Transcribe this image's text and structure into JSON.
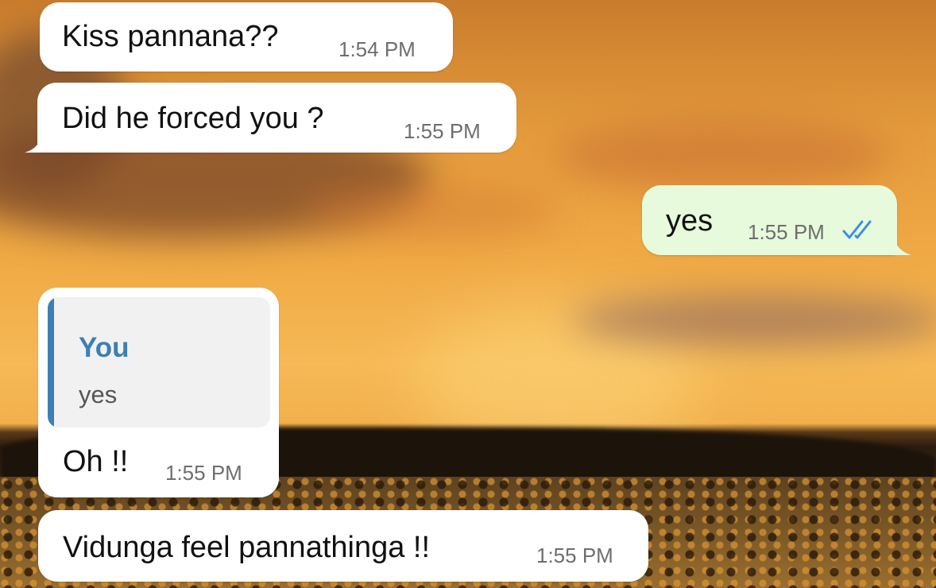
{
  "messages": [
    {
      "text": "Kiss pannana??",
      "time": "1:54 PM",
      "direction": "incoming"
    },
    {
      "text": "Did he forced you ?",
      "time": "1:55 PM",
      "direction": "incoming"
    },
    {
      "text": "yes",
      "time": "1:55 PM",
      "direction": "outgoing",
      "status": "read",
      "status_icon": "double-check-icon"
    },
    {
      "text": "Oh !!",
      "time": "1:55 PM",
      "direction": "incoming",
      "reply_to": {
        "author": "You",
        "text": "yes"
      }
    },
    {
      "text": "Vidunga feel pannathinga !!",
      "time": "1:55 PM",
      "direction": "incoming"
    }
  ],
  "colors": {
    "incoming_bubble": "#ffffff",
    "outgoing_bubble": "#e7fadc",
    "read_ticks": "#3a8ee6",
    "quote_accent": "#3d7fb3"
  }
}
